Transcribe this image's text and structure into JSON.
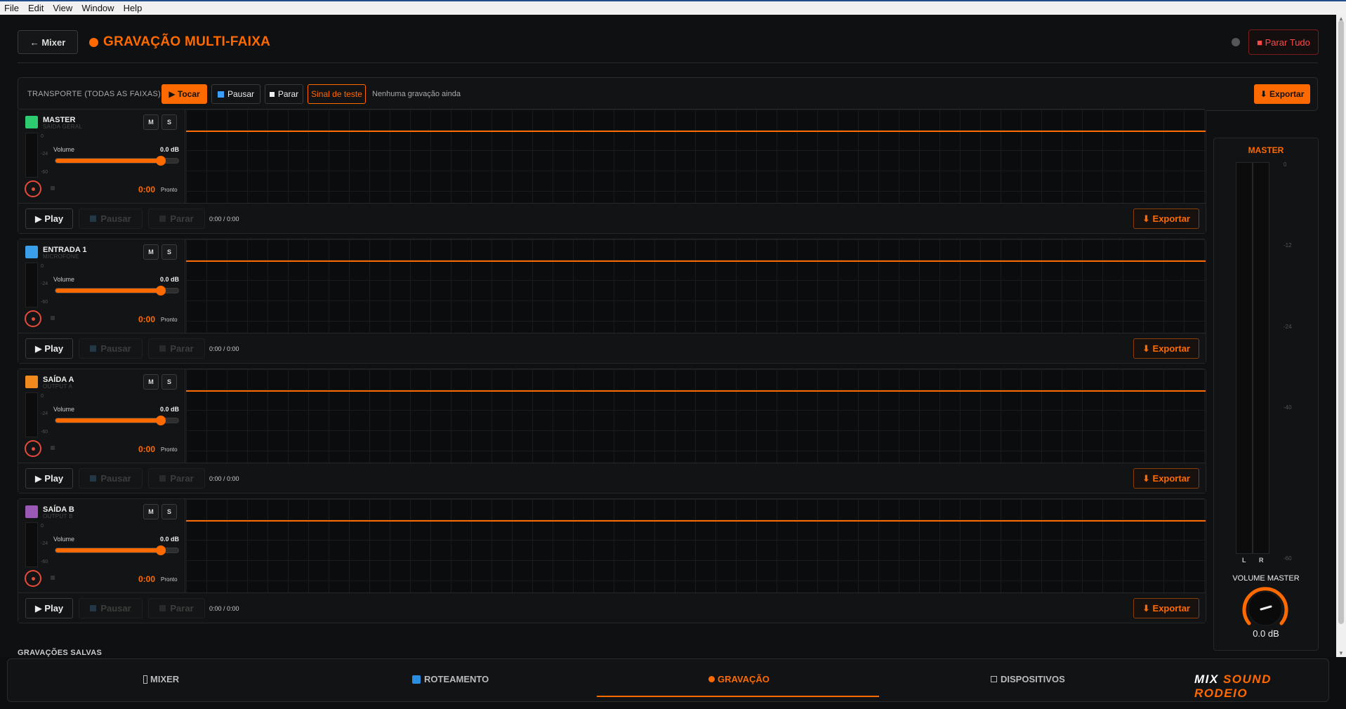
{
  "menu": [
    "File",
    "Edit",
    "View",
    "Window",
    "Help"
  ],
  "header": {
    "back_label": "← Mixer",
    "title": "GRAVAÇÃO MULTI-FAIXA",
    "stop_all_label": "■ Parar Tudo"
  },
  "transport": {
    "label": "TRANSPORTE (TODAS AS FAIXAS):",
    "play_label": "▶ Tocar",
    "pause_label": "Pausar",
    "stop_label": "Parar",
    "test_signal_label": "Sinal de teste",
    "status": "Nenhuma gravação ainda",
    "export_label": "⬇ Exportar"
  },
  "tracks": [
    {
      "name": "MASTER",
      "subtitle": "SAÍDA GERAL",
      "color": "#2ecc71",
      "mute": "M",
      "solo": "S",
      "scale": [
        "0",
        "-24",
        "-60"
      ],
      "volume_label": "Volume",
      "db": "0.0 dB",
      "volume": 0.85,
      "time": "0:00",
      "state": "Pronto",
      "play": "▶ Play",
      "pause": "Pausar",
      "stop": "Parar",
      "position": "0:00 / 0:00",
      "export": "⬇ Exportar"
    },
    {
      "name": "ENTRADA 1",
      "subtitle": "MICROFONE",
      "color": "#3a9ee8",
      "mute": "M",
      "solo": "S",
      "scale": [
        "0",
        "-24",
        "-60"
      ],
      "volume_label": "Volume",
      "db": "0.0 dB",
      "volume": 0.85,
      "time": "0:00",
      "state": "Pronto",
      "play": "▶ Play",
      "pause": "Pausar",
      "stop": "Parar",
      "position": "0:00 / 0:00",
      "export": "⬇ Exportar"
    },
    {
      "name": "SAÍDA A",
      "subtitle": "OUTPUT A",
      "color": "#f08a1e",
      "mute": "M",
      "solo": "S",
      "scale": [
        "0",
        "-24",
        "-60"
      ],
      "volume_label": "Volume",
      "db": "0.0 dB",
      "volume": 0.85,
      "time": "0:00",
      "state": "Pronto",
      "play": "▶ Play",
      "pause": "Pausar",
      "stop": "Parar",
      "position": "0:00 / 0:00",
      "export": "⬇ Exportar"
    },
    {
      "name": "SAÍDA B",
      "subtitle": "OUTPUT B",
      "color": "#9b59b6",
      "mute": "M",
      "solo": "S",
      "scale": [
        "0",
        "-24",
        "-60"
      ],
      "volume_label": "Volume",
      "db": "0.0 dB",
      "volume": 0.85,
      "time": "0:00",
      "state": "Pronto",
      "play": "▶ Play",
      "pause": "Pausar",
      "stop": "Parar",
      "position": "0:00 / 0:00",
      "export": "⬇ Exportar"
    }
  ],
  "master": {
    "title": "MASTER",
    "scale": [
      "0",
      "-12",
      "-24",
      "-40",
      "-60"
    ],
    "left_label": "L",
    "right_label": "R",
    "volume_label": "VOLUME MASTER",
    "volume_value": "0.0 dB"
  },
  "saved_title": "GRAVAÇÕES SALVAS",
  "nav": {
    "mixer": "MIXER",
    "routing": "ROTEAMENTO",
    "recording": "GRAVAÇÃO",
    "devices": "DISPOSITIVOS",
    "active": "recording"
  },
  "brand": {
    "part1": "MIX",
    "part2": "SOUND RODEIO"
  },
  "colors": {
    "accent": "#ff6a00",
    "danger": "#e84a3a",
    "background": "#0f1011"
  }
}
